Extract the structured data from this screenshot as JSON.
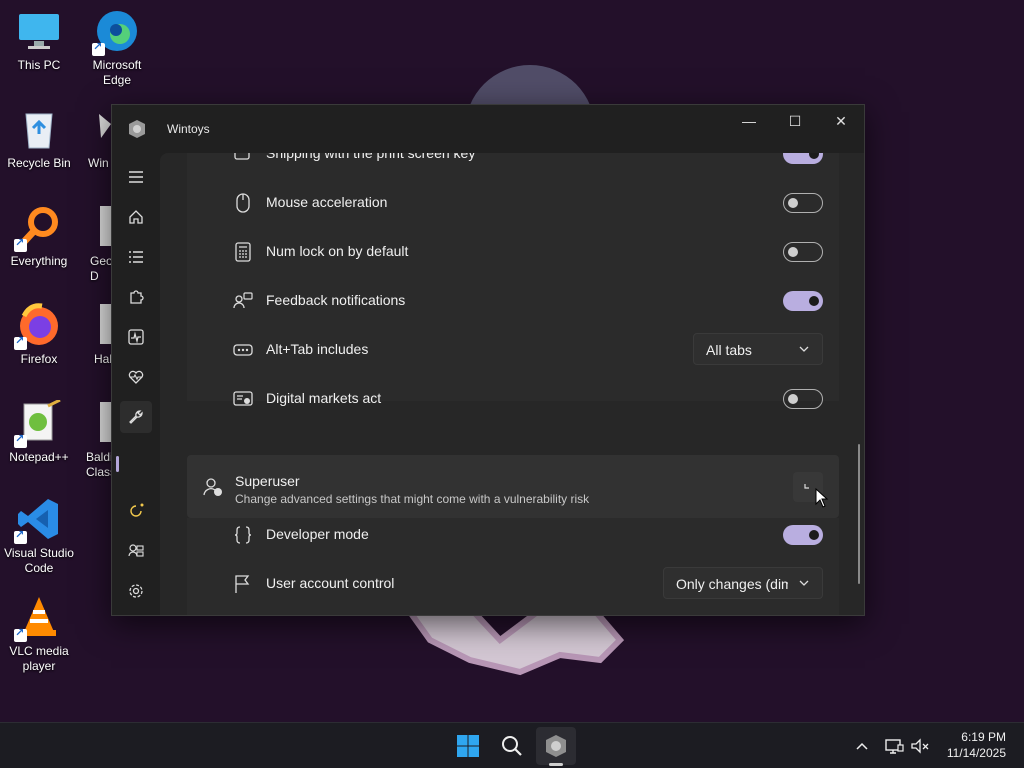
{
  "desktop": {
    "icons": [
      {
        "label": "This PC",
        "icon": "monitor-icon"
      },
      {
        "label": "Microsoft Edge",
        "icon": "edge-icon"
      },
      {
        "label": "Recycle Bin",
        "icon": "recycle-bin-icon"
      },
      {
        "label": "Win",
        "icon": "wintoys-shortcut-icon"
      },
      {
        "label": "Everything",
        "icon": "everything-search-icon"
      },
      {
        "label": "Geo D",
        "icon": "file-icon"
      },
      {
        "label": "Firefox",
        "icon": "firefox-icon"
      },
      {
        "label": "Hal",
        "icon": "file-icon"
      },
      {
        "label": "Notepad++",
        "icon": "notepadpp-icon"
      },
      {
        "label": "Baldi' Class",
        "icon": "file-icon"
      },
      {
        "label": "Visual Studio Code",
        "icon": "vscode-icon"
      },
      {
        "label": "VLC media player",
        "icon": "vlc-icon"
      }
    ]
  },
  "window": {
    "title": "Wintoys",
    "caption": {
      "minimize": "—",
      "maximize": "☐",
      "close": "✕"
    },
    "nav": [
      {
        "name": "menu",
        "icon": "hamburger-icon"
      },
      {
        "name": "home",
        "icon": "home-icon"
      },
      {
        "name": "apps",
        "icon": "list-icon"
      },
      {
        "name": "services",
        "icon": "puzzle-icon"
      },
      {
        "name": "performance",
        "icon": "activity-icon"
      },
      {
        "name": "health",
        "icon": "heart-pulse-icon"
      },
      {
        "name": "tweaks",
        "icon": "wrench-icon",
        "active": true
      },
      {
        "name": "updates",
        "icon": "refresh-icon"
      },
      {
        "name": "account",
        "icon": "people-icon"
      },
      {
        "name": "settings",
        "icon": "gear-icon"
      }
    ],
    "rows": [
      {
        "label": "Snipping with the print screen key",
        "control": "toggle",
        "on": true
      },
      {
        "label": "Mouse acceleration",
        "control": "toggle",
        "on": false
      },
      {
        "label": "Num lock on by default",
        "control": "toggle",
        "on": false
      },
      {
        "label": "Feedback notifications",
        "control": "toggle",
        "on": true
      },
      {
        "label": "Alt+Tab includes",
        "control": "dropdown",
        "value": "All tabs"
      },
      {
        "label": "Digital markets act",
        "control": "toggle",
        "on": false
      }
    ],
    "superuser": {
      "title": "Superuser",
      "description": "Change advanced settings that might come with a vulnerability risk"
    },
    "superuser_rows": [
      {
        "label": "Developer mode",
        "control": "toggle",
        "on": true
      },
      {
        "label": "User account control",
        "control": "dropdown",
        "value": "Only changes (dim"
      }
    ]
  },
  "taskbar": {
    "time": "6:19 PM",
    "date": "11/14/2025",
    "tray": [
      "chevron-up-icon",
      "network-icon",
      "volume-muted-icon"
    ]
  },
  "colors": {
    "accent": "#b9aee0",
    "window_bg": "#202020",
    "card_bg": "#2b2b2b",
    "desktop_bg": "#23102a"
  }
}
